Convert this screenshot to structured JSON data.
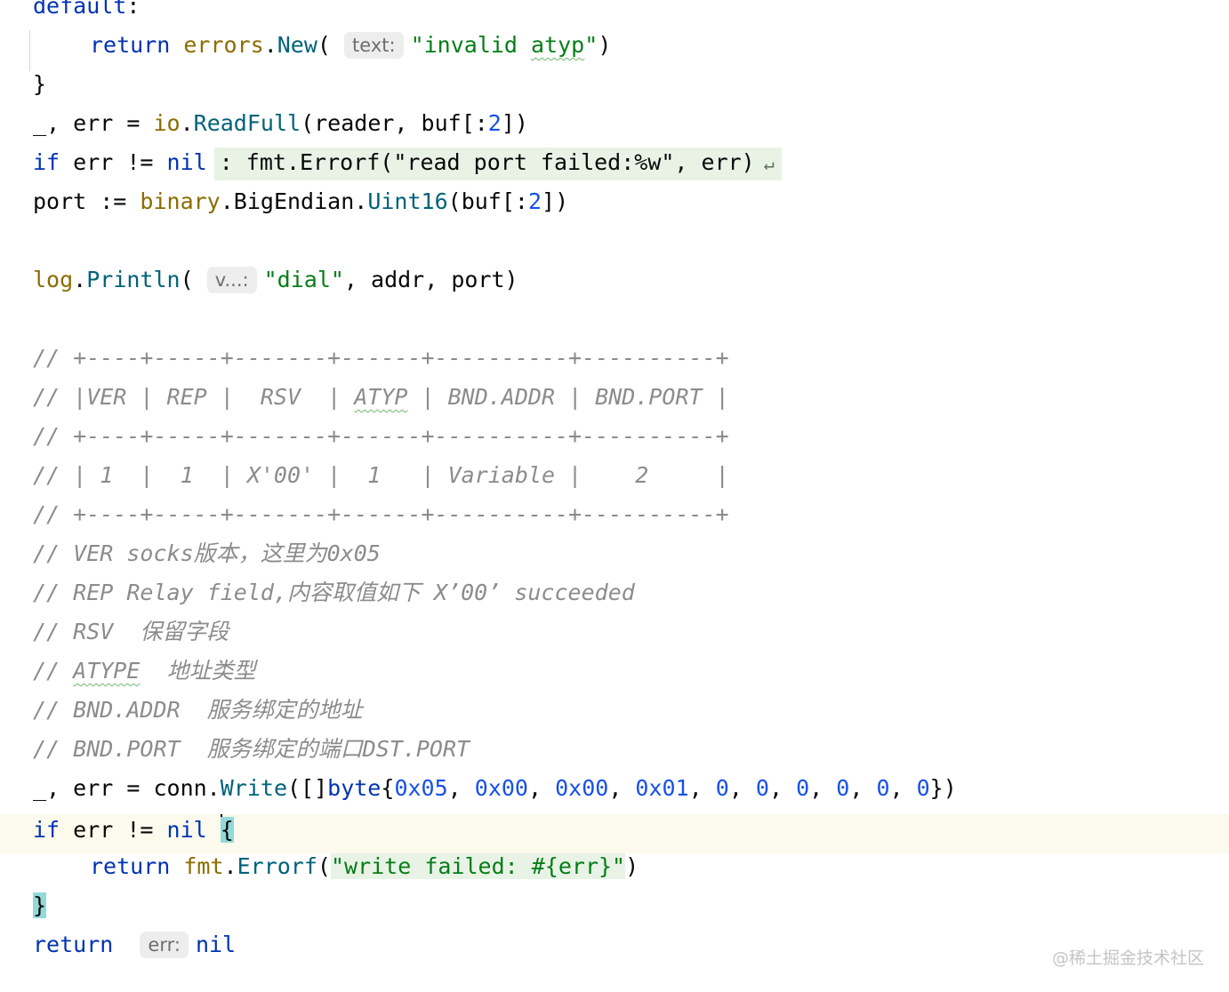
{
  "code": {
    "l1": {
      "default_kw": "default",
      "colon": ":"
    },
    "l2": {
      "return_kw": "return",
      "pkg": "errors",
      "dot": ".",
      "fn": "New",
      "open": "(",
      "hint": "text:",
      "str_open": "\"invalid ",
      "str_typo": "atyp",
      "str_close": "\"",
      "close": ")"
    },
    "l3": {
      "brace": "}"
    },
    "l4": {
      "underscore": "_",
      "rest1": ", err = ",
      "pkg": "io",
      "dot": ".",
      "fn": "ReadFull",
      "args": "(reader, buf[:",
      "num": "2",
      "end": "])"
    },
    "l5": {
      "if_kw": "if",
      "cond": " err != ",
      "nil_kw": "nil",
      "fold_text": ": fmt.Errorf(\"read port failed:%w\", err)",
      "fold_arrow": "↵"
    },
    "l6": {
      "id": "port := ",
      "pkg": "binary",
      "dot1": ".",
      "type": "BigEndian",
      "dot2": ".",
      "fn": "Uint16",
      "args": "(buf[:",
      "num": "2",
      "end": "])"
    },
    "l8": {
      "pkg": "log",
      "dot": ".",
      "fn": "Println",
      "open": "(",
      "hint": "v...:",
      "str": "\"dial\"",
      "rest": ", addr, port)"
    },
    "comments": {
      "c1": "// +----+-----+-------+------+----------+----------+",
      "c2a": "// |VER | REP |  RSV  | ",
      "c2typo": "ATYP",
      "c2b": " | BND.ADDR | BND.PORT |",
      "c3": "// +----+-----+-------+------+----------+----------+",
      "c4": "// | 1  |  1  | X'00' |  1   | Variable |    2     |",
      "c5": "// +----+-----+-------+------+----------+----------+",
      "c6": "// VER socks版本，这里为0x05",
      "c7": "// REP Relay field,内容取值如下 X’00’ succeeded",
      "c8": "// RSV  保留字段",
      "c9a": "// ",
      "c9typo": "ATYPE",
      "c9b": "  地址类型",
      "c10": "// BND.ADDR  服务绑定的地址",
      "c11": "// BND.PORT  服务绑定的端口DST.PORT"
    },
    "l21": {
      "underscore": "_",
      "rest1": ", err = conn.",
      "fn": "Write",
      "open": "([]",
      "type_kw": "byte",
      "brace": "{",
      "n1": "0x05",
      "sep1": ", ",
      "n2": "0x00",
      "sep2": ", ",
      "n3": "0x00",
      "sep3": ", ",
      "n4": "0x01",
      "sep4": ", ",
      "n5": "0",
      "sep5": ", ",
      "n6": "0",
      "sep6": ", ",
      "n7": "0",
      "sep7": ", ",
      "n8": "0",
      "sep8": ", ",
      "n9": "0",
      "sep9": ", ",
      "n10": "0",
      "end": "})"
    },
    "l22": {
      "if_kw": "if",
      "cond": " err != ",
      "nil_kw": "nil",
      "space": " ",
      "brace": "{"
    },
    "l23": {
      "return_kw": "return",
      "pkg": "fmt",
      "dot": ".",
      "fn": "Errorf",
      "open": "(",
      "str": "\"write failed: #{err}\"",
      "close": ")"
    },
    "l24": {
      "brace": "}"
    },
    "l25": {
      "return_kw": "return",
      "hint": "err:",
      "nil_kw": "nil"
    }
  },
  "watermark": "@稀土掘金技术社区",
  "colors": {
    "keyword": "#0033b3",
    "package": "#8c6c00",
    "function": "#00627a",
    "string": "#067d17",
    "number": "#1750eb",
    "comment": "#8c8c8c",
    "current_line": "#fcfaed",
    "brace_match": "#93d9d9"
  }
}
